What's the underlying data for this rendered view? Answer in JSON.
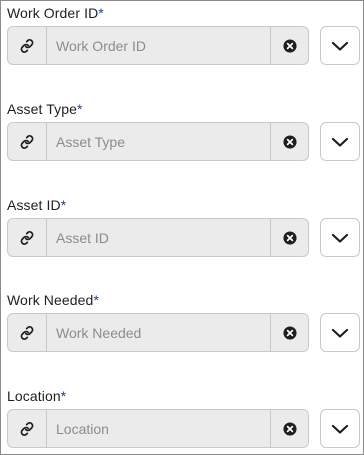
{
  "fields": [
    {
      "label": "Work Order ID",
      "required_mark": "*",
      "placeholder": "Work Order ID",
      "value": ""
    },
    {
      "label": "Asset Type",
      "required_mark": "*",
      "placeholder": "Asset Type",
      "value": ""
    },
    {
      "label": "Asset ID",
      "required_mark": "*",
      "placeholder": "Asset ID",
      "value": ""
    },
    {
      "label": "Work Needed",
      "required_mark": "*",
      "placeholder": "Work Needed",
      "value": ""
    },
    {
      "label": "Location",
      "required_mark": "*",
      "placeholder": "Location",
      "value": ""
    }
  ],
  "icons": {
    "link": "link-icon",
    "clear": "clear-circle-x-icon",
    "dropdown": "chevron-down-icon"
  },
  "colors": {
    "required_mark": "#1b3fa0",
    "input_background": "#ebebeb",
    "border": "#c9c9c9"
  }
}
